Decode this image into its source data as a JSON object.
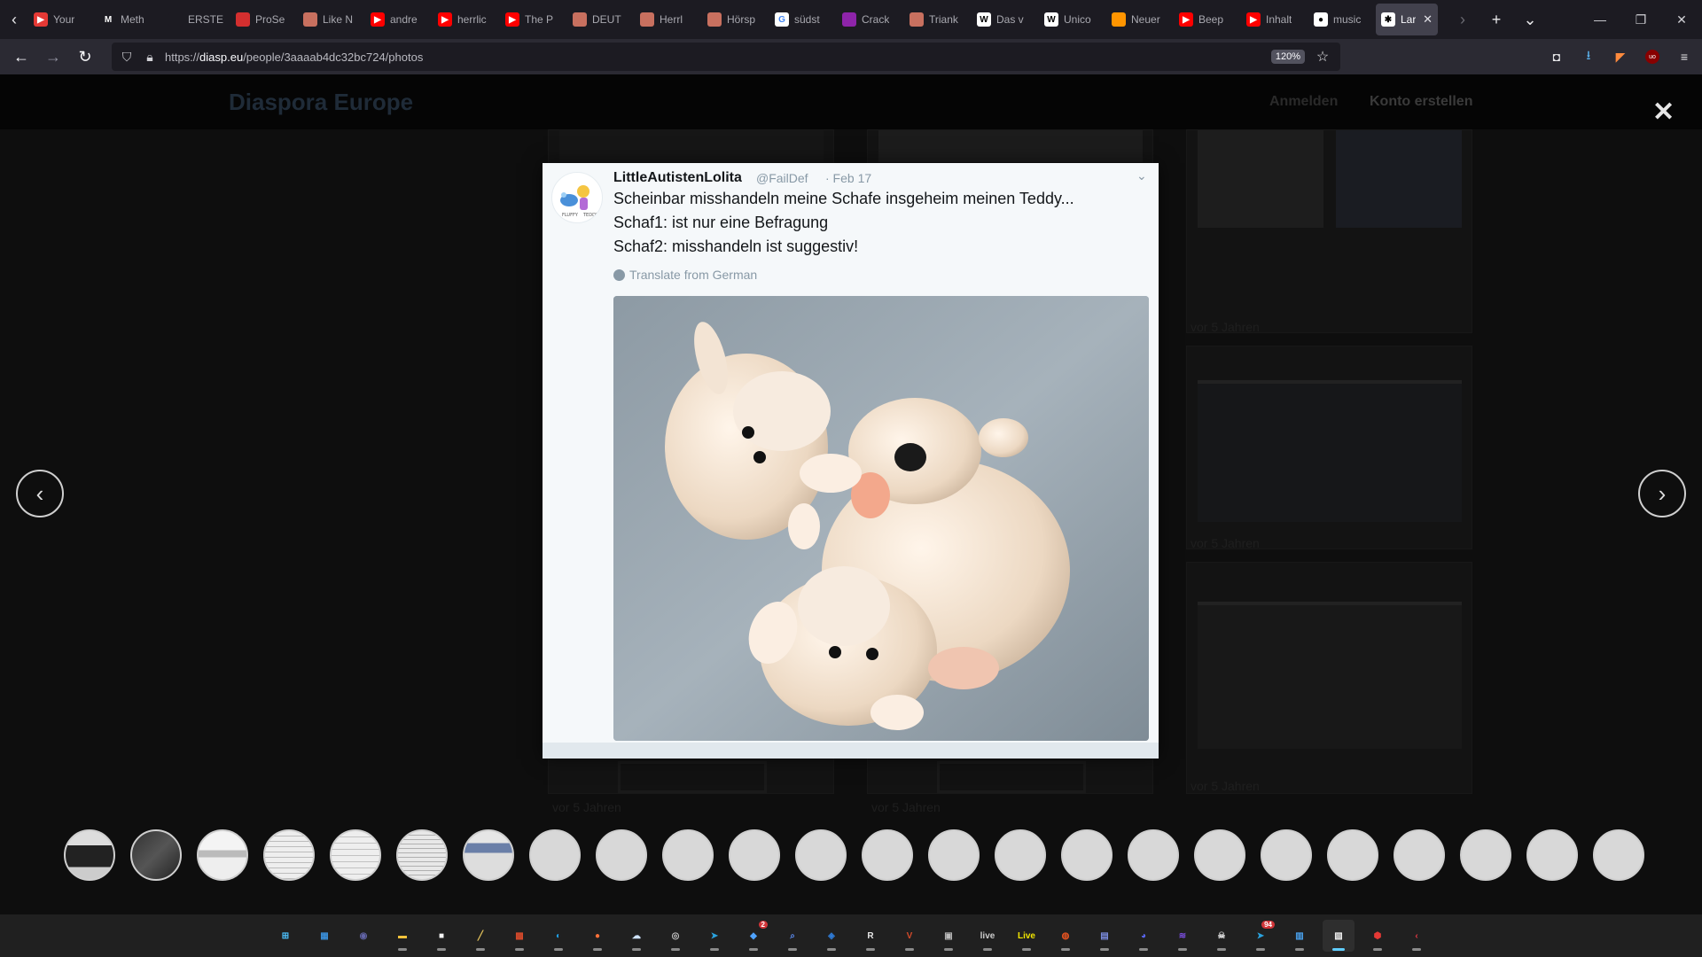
{
  "browser": {
    "tabs": [
      {
        "label": "Your",
        "icon": "youtube-icon",
        "color": "#e53935"
      },
      {
        "label": "Meth",
        "icon": "m-logo-icon",
        "color": "#222222"
      },
      {
        "label": "ERSTE A",
        "icon": "blank-icon",
        "color": "#1c1b22"
      },
      {
        "label": "ProSe",
        "icon": "pdf-icon",
        "color": "#d32f2f"
      },
      {
        "label": "Like N",
        "icon": "image-icon",
        "color": "#c8705f"
      },
      {
        "label": "andre",
        "icon": "youtube-icon",
        "color": "#ff0000"
      },
      {
        "label": "herrlic",
        "icon": "youtube-icon",
        "color": "#ff0000"
      },
      {
        "label": "The P",
        "icon": "youtube-icon",
        "color": "#ff0000"
      },
      {
        "label": "DEUT",
        "icon": "image-icon",
        "color": "#c8705f"
      },
      {
        "label": "Herrl",
        "icon": "image-icon",
        "color": "#c8705f"
      },
      {
        "label": "Hörsp",
        "icon": "image-icon",
        "color": "#c8705f"
      },
      {
        "label": "südst",
        "icon": "google-icon",
        "color": "#ffffff"
      },
      {
        "label": "Crack",
        "icon": "purple-icon",
        "color": "#8e24aa"
      },
      {
        "label": "Triank",
        "icon": "image-icon",
        "color": "#c8705f"
      },
      {
        "label": "Das v",
        "icon": "wikipedia-icon",
        "color": "#ffffff"
      },
      {
        "label": "Unico",
        "icon": "wikipedia-icon",
        "color": "#ffffff"
      },
      {
        "label": "Neuer",
        "icon": "firefox-icon",
        "color": "#ff9500"
      },
      {
        "label": "Beep",
        "icon": "youtube-icon",
        "color": "#ff0000"
      },
      {
        "label": "Inhalt",
        "icon": "youtube-icon",
        "color": "#ff0000"
      },
      {
        "label": "music",
        "icon": "github-icon",
        "color": "#ffffff"
      },
      {
        "label": "Lar",
        "icon": "diaspora-icon",
        "color": "#ffffff",
        "active": true,
        "close": "✕"
      }
    ],
    "url_host": "diasp.eu",
    "url_prefix": "https://",
    "url_path": "/people/3aaaab4dc32bc724/photos",
    "zoom": "120%"
  },
  "site": {
    "title": "Diaspora Europe",
    "login": "Anmelden",
    "signup": "Konto erstellen",
    "close_glyph": "✕",
    "captions": [
      "vor 5 Jahren",
      "vor 5 Jahren",
      "vor 5 Jahren",
      "vor 5 Jahren",
      "vor 5 Jahren",
      "vor 5 Jahren"
    ]
  },
  "tweet": {
    "name": "LittleAutistenLolita",
    "handle": "@FailDef",
    "date": "· Feb 17",
    "lines": [
      "Scheinbar misshandeln meine Schafe insgeheim meinen Teddy...",
      "Schaf1: ist nur eine Befragung",
      "Schaf2: misshandeln ist suggestiv!"
    ],
    "translate": "Translate from German",
    "photo_icon": "plush-toys-photo"
  },
  "lightbox": {
    "prev_glyph": "‹",
    "next_glyph": "›",
    "thumb_count": 24,
    "strip_next_glyph": "▶"
  },
  "taskbar": {
    "apps": [
      {
        "name": "start-icon",
        "color": "#4cc2ff",
        "glyph": "⊞"
      },
      {
        "name": "widgets-icon",
        "color": "#3a8fd9",
        "glyph": "▦"
      },
      {
        "name": "teams-chat-icon",
        "color": "#6264a7",
        "glyph": "◉"
      },
      {
        "name": "file-explorer-icon",
        "color": "#f3c33b",
        "glyph": "▬"
      },
      {
        "name": "store-icon",
        "color": "#f5f5f5",
        "glyph": "■"
      },
      {
        "name": "pen-icon",
        "color": "#e0c05a",
        "glyph": "╱"
      },
      {
        "name": "calculator-icon",
        "color": "#d84a2b",
        "glyph": "▩"
      },
      {
        "name": "edge-icon",
        "color": "#1fa0e6",
        "glyph": "◐"
      },
      {
        "name": "firefox-icon",
        "color": "#ff7139",
        "glyph": "●"
      },
      {
        "name": "cloud-icon",
        "color": "#cfe3ff",
        "glyph": "☁"
      },
      {
        "name": "steam-icon",
        "color": "#c6c6c6",
        "glyph": "◎"
      },
      {
        "name": "telegram-icon",
        "color": "#2aa3df",
        "glyph": "➤"
      },
      {
        "name": "messenger-icon",
        "color": "#4fa3ff",
        "glyph": "◆",
        "badge": "2"
      },
      {
        "name": "search-app-icon",
        "color": "#5b8cf0",
        "glyph": "⌕"
      },
      {
        "name": "kodi-icon",
        "color": "#2f7bd6",
        "glyph": "◈"
      },
      {
        "name": "r-app-icon",
        "color": "#e6e6e6",
        "glyph": "R"
      },
      {
        "name": "voicemeeter-icon",
        "color": "#d24a2a",
        "glyph": "V"
      },
      {
        "name": "media-icon",
        "color": "#bbbbbb",
        "glyph": "▣"
      },
      {
        "name": "live-icon",
        "color": "#cccccc",
        "glyph": "live"
      },
      {
        "name": "ableton-live-icon",
        "color": "#f2e600",
        "glyph": "Live"
      },
      {
        "name": "ubuntu-icon",
        "color": "#e95420",
        "glyph": "◍"
      },
      {
        "name": "floppy-icon",
        "color": "#7b8ce0",
        "glyph": "▤"
      },
      {
        "name": "discord-icon",
        "color": "#5865f2",
        "glyph": "◕"
      },
      {
        "name": "bars-app-icon",
        "color": "#7b4ee0",
        "glyph": "≋"
      },
      {
        "name": "skull-app-icon",
        "color": "#dddddd",
        "glyph": "☠"
      },
      {
        "name": "telegram-badge-icon",
        "color": "#2aa3df",
        "glyph": "➤",
        "badge": "94"
      },
      {
        "name": "notepad-icon",
        "color": "#4aa3f0",
        "glyph": "▥"
      },
      {
        "name": "active-doc-icon",
        "color": "#f0f0f0",
        "glyph": "▧",
        "active": true
      },
      {
        "name": "shield-app-icon",
        "color": "#e53935",
        "glyph": "⬢"
      },
      {
        "name": "git-app-icon",
        "color": "#e53945",
        "glyph": "‹"
      }
    ]
  }
}
